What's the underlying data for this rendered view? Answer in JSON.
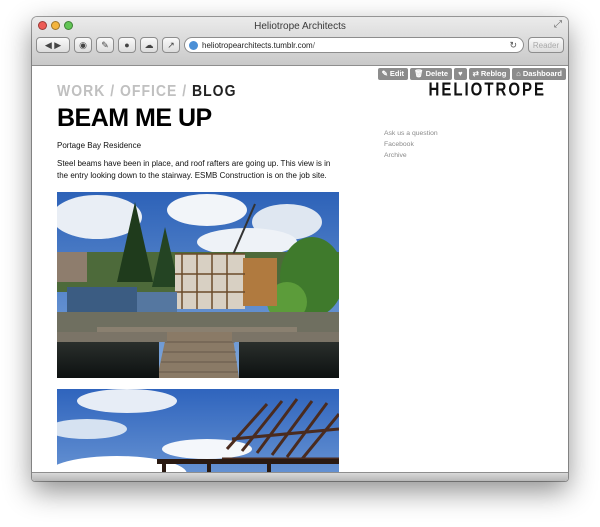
{
  "window": {
    "title": "Heliotrope Architects",
    "url_host": "heliotropearchitects.tumblr.com",
    "url_path": "/",
    "reader_label": "Reader"
  },
  "nav": {
    "work": "WORK",
    "office": "OFFICE",
    "blog": "BLOG",
    "sep": "/"
  },
  "brand": "HELIOTROPE",
  "tumblr_controls": {
    "edit": "Edit",
    "delete": "Delete",
    "reblog": "Reblog",
    "dashboard": "Dashboard"
  },
  "post": {
    "title": "BEAM ME UP",
    "subtitle": "Portage Bay Residence",
    "body": "Steel beams have been in place, and roof rafters are going up. This view is in the entry looking down to the stairway.  ESMB Construction is on the job site."
  },
  "sidebar": {
    "links": [
      "Ask us a question",
      "Facebook",
      "Archive"
    ]
  }
}
